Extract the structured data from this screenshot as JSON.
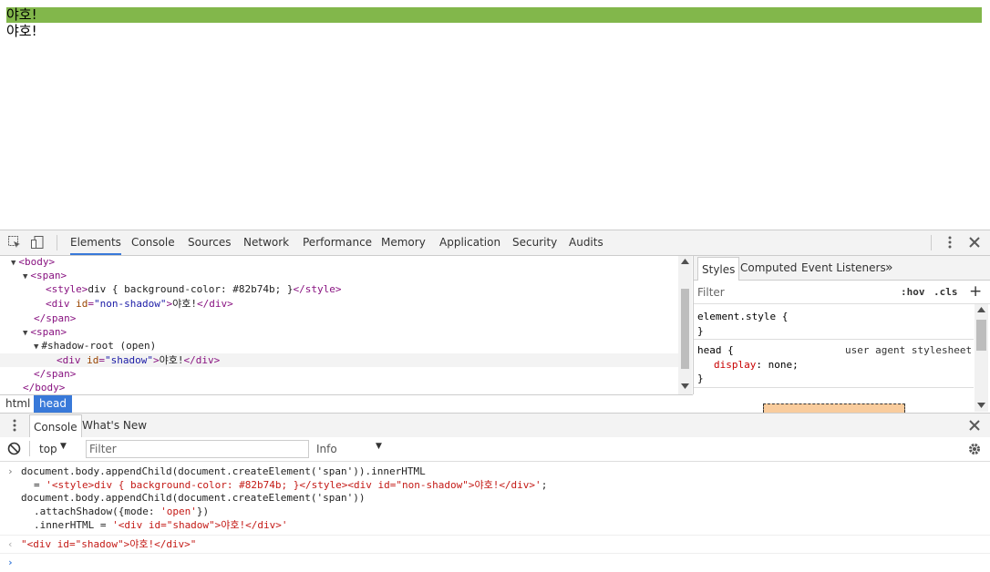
{
  "page": {
    "line1": "야호!",
    "line2": "야호!",
    "highlight_color": "#82b74b"
  },
  "toolbar": {
    "tabs": [
      "Elements",
      "Console",
      "Sources",
      "Network",
      "Performance",
      "Memory",
      "Application",
      "Security",
      "Audits"
    ],
    "active_tab": "Elements",
    "more_icon": "kebab-menu-icon",
    "close_icon": "close-icon"
  },
  "dom": {
    "body_open": "<body>",
    "span1_open": "<span>",
    "style_open": "<style>",
    "style_text": "div { background-color: #82b74b; }",
    "style_close": "</style>",
    "div_open": "<div",
    "div_attr": "id",
    "div1_val": "\"non-shadow\"",
    "div_gt": ">",
    "div_text": "야호!",
    "div_close": "</div>",
    "span_close": "</span>",
    "span2_open": "<span>",
    "shadow_root": "#shadow-root (open)",
    "div2_val": "\"shadow\"",
    "body_close": "</body>"
  },
  "breadcrumbs": [
    "html",
    "head"
  ],
  "styles": {
    "tabs": [
      "Styles",
      "Computed",
      "Event Listeners"
    ],
    "overflow_label": "»",
    "filter_placeholder": "Filter",
    "hov_label": ":hov",
    "cls_label": ".cls",
    "add_label": "+",
    "element_style": "element.style {",
    "close_brace": "}",
    "head_selector": "head {",
    "ua_label": "user agent stylesheet",
    "prop_name": "display",
    "prop_value": "none;"
  },
  "drawer": {
    "tabs": [
      "Console",
      "What's New"
    ],
    "context": "top",
    "filter_placeholder": "Filter",
    "level": "Info"
  },
  "console": {
    "input1_line1": "document.body.appendChild(document.createElement('span')).innerHTML",
    "input1_line2_eq": "= ",
    "input1_line2_str": "'<style>div { background-color: #82b74b; }</style><div id=\"non-shadow\">야호!</div>'",
    "input1_line2_end": ";",
    "input1_line3": "document.body.appendChild(document.createElement('span'))",
    "input1_line4_a": ".attachShadow({mode: ",
    "input1_line4_str": "'open'",
    "input1_line4_b": "})",
    "input1_line5_a": ".innerHTML = ",
    "input1_line5_str": "'<div id=\"shadow\">야호!</div>'",
    "result": "\"<div id=\"shadow\">야호!</div>\"",
    "prompt_caret": "›",
    "result_caret": "‹"
  }
}
